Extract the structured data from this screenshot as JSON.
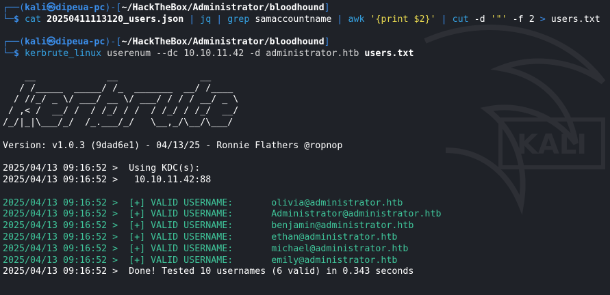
{
  "prompt": {
    "user": "kali",
    "host": "dipeua-pc",
    "cwd": "~/HackTheBox/Administrator/bloodhound"
  },
  "commands": [
    {
      "segments": [
        {
          "t": "cat",
          "c": "cmd"
        },
        {
          "t": " ",
          "c": "white"
        },
        {
          "t": "20250411113120_users.json",
          "c": "path"
        },
        {
          "t": " | ",
          "c": "pipeop"
        },
        {
          "t": "jq",
          "c": "cmd"
        },
        {
          "t": " | ",
          "c": "pipeop"
        },
        {
          "t": "grep",
          "c": "cmd"
        },
        {
          "t": " samaccountname ",
          "c": "white"
        },
        {
          "t": "| ",
          "c": "pipeop"
        },
        {
          "t": "awk",
          "c": "cmd"
        },
        {
          "t": " '{print $2}'",
          "c": "str"
        },
        {
          "t": " | ",
          "c": "pipeop"
        },
        {
          "t": "cut",
          "c": "cmd"
        },
        {
          "t": " -d ",
          "c": "white"
        },
        {
          "t": "'\"'",
          "c": "str"
        },
        {
          "t": " -f 2 ",
          "c": "white"
        },
        {
          "t": "> ",
          "c": "pipeop"
        },
        {
          "t": "users.txt",
          "c": "white"
        }
      ]
    },
    {
      "segments": [
        {
          "t": "kerbrute_linux",
          "c": "cmd"
        },
        {
          "t": " userenum --dc 10.10.11.42 -d administrator.htb ",
          "c": "gray"
        },
        {
          "t": "users.txt",
          "c": "path"
        }
      ]
    }
  ],
  "banner": [
    "    __             __               __     ",
    "   / /_____  _____/ /_  _______  __/ /____ ",
    "  / //_/ _ \\/ ___/ __ \\/ ___/ / / / __/ _ \\",
    " / ,< /  __/ /  / /_/ / /  / /_/ / /_/  __/",
    "/_/|_|\\___/_/  /_.___/_/   \\__,_/\\__/\\___/ "
  ],
  "version_line": "Version: v1.0.3 (9dad6e1) - 04/13/25 - Ronnie Flathers @ropnop",
  "kdc_lines": [
    "2025/04/13 09:16:52 >  Using KDC(s):",
    "2025/04/13 09:16:52 >   10.10.11.42:88"
  ],
  "valid_lines": [
    {
      "ts": "2025/04/13 09:16:52 >  ",
      "tag": "[+] VALID USERNAME:",
      "user": "olivia@administrator.htb"
    },
    {
      "ts": "2025/04/13 09:16:52 >  ",
      "tag": "[+] VALID USERNAME:",
      "user": "Administrator@administrator.htb"
    },
    {
      "ts": "2025/04/13 09:16:52 >  ",
      "tag": "[+] VALID USERNAME:",
      "user": "benjamin@administrator.htb"
    },
    {
      "ts": "2025/04/13 09:16:52 >  ",
      "tag": "[+] VALID USERNAME:",
      "user": "ethan@administrator.htb"
    },
    {
      "ts": "2025/04/13 09:16:52 >  ",
      "tag": "[+] VALID USERNAME:",
      "user": "michael@administrator.htb"
    },
    {
      "ts": "2025/04/13 09:16:52 >  ",
      "tag": "[+] VALID USERNAME:",
      "user": "emily@administrator.htb"
    }
  ],
  "done_line": "2025/04/13 09:16:52 >  Done! Tested 10 usernames (6 valid) in 0.343 seconds",
  "watermark_text": "KALI",
  "colors": {
    "background": "#1f2228",
    "prompt_blue": "#3b8eea",
    "valid_green": "#3fc59a",
    "string_yellow": "#e5d64f"
  }
}
